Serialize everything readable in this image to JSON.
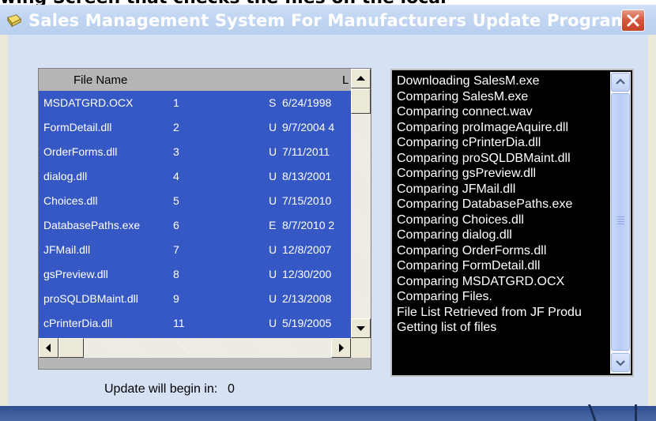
{
  "caption": "wing Screen that checks the files on the local",
  "window": {
    "title": "Sales Management System For Manufacturers Update Program",
    "close_label": "×"
  },
  "file_list": {
    "headers": [
      "File Name",
      "L"
    ],
    "rows": [
      {
        "name": "MSDATGRD.OCX",
        "num": "1",
        "type": "S",
        "date": "6/24/1998"
      },
      {
        "name": "FormDetail.dll",
        "num": "2",
        "type": "U",
        "date": "9/7/2004 4"
      },
      {
        "name": "OrderForms.dll",
        "num": "3",
        "type": "U",
        "date": "7/11/2011"
      },
      {
        "name": "dialog.dll",
        "num": "4",
        "type": "U",
        "date": "8/13/2001"
      },
      {
        "name": "Choices.dll",
        "num": "5",
        "type": "U",
        "date": "7/15/2010"
      },
      {
        "name": "DatabasePaths.exe",
        "num": "6",
        "type": "E",
        "date": "8/7/2010 2"
      },
      {
        "name": "JFMail.dll",
        "num": "7",
        "type": "U",
        "date": "12/8/2007"
      },
      {
        "name": "gsPreview.dll",
        "num": "8",
        "type": "U",
        "date": "12/30/200"
      },
      {
        "name": "proSQLDBMaint.dll",
        "num": "9",
        "type": "U",
        "date": "2/13/2008"
      },
      {
        "name": "cPrinterDia.dll",
        "num": "11",
        "type": "U",
        "date": "5/19/2005"
      }
    ]
  },
  "countdown": {
    "label": "Update will begin in:",
    "value": "0"
  },
  "log": {
    "lines": [
      "Downloading SalesM.exe",
      "Comparing SalesM.exe",
      "Comparing connect.wav",
      "Comparing proImageAquire.dll",
      "Comparing cPrinterDia.dll",
      "Comparing proSQLDBMaint.dll",
      "Comparing gsPreview.dll",
      "Comparing JFMail.dll",
      "Comparing DatabasePaths.exe",
      "Comparing Choices.dll",
      "Comparing dialog.dll",
      "Comparing OrderForms.dll",
      "Comparing FormDetail.dll",
      "Comparing MSDATGRD.OCX",
      "Comparing Files.",
      "File List Retrieved from JF Produ",
      "Getting list of files"
    ]
  },
  "colors": {
    "selection": "#3658c4",
    "title_gradient": "#c2d6f2",
    "log_background": "#000000"
  }
}
